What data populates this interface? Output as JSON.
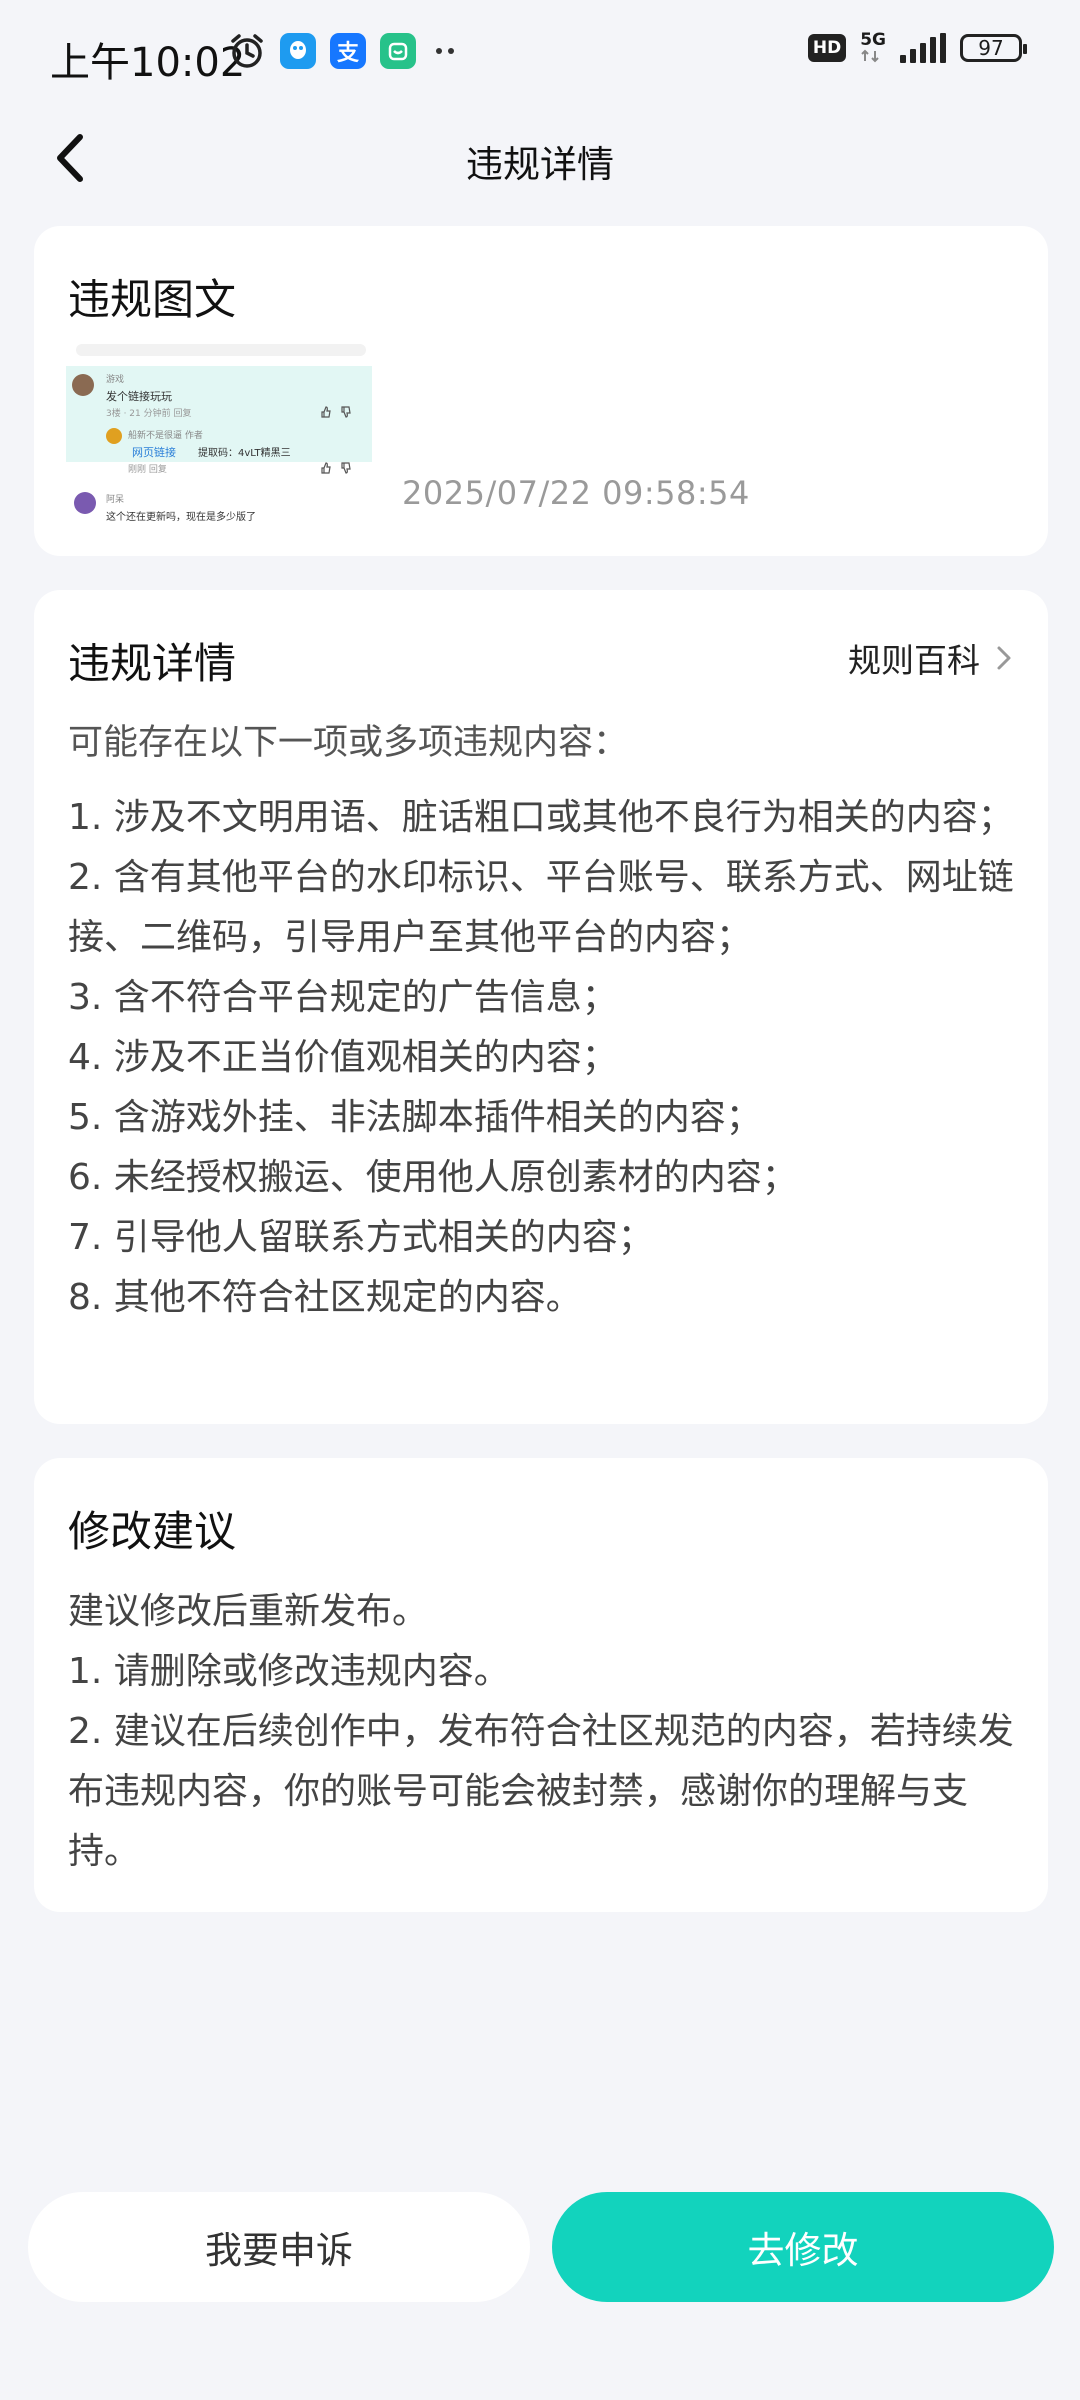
{
  "status_bar": {
    "time": "上午10:02",
    "hd": "HD",
    "network": "5G",
    "battery": "97"
  },
  "nav": {
    "title": "违规详情"
  },
  "violation_content": {
    "title": "违规图文",
    "timestamp": "2025/07/22 09:58:54",
    "thumbnail": {
      "comment1_user": "游戏",
      "comment1_text": "发个链接玩玩",
      "comment1_meta": "3楼 · 21 分钟前  回复",
      "reply_user": "船新不是很逼  作者",
      "reply_link": "网页链接",
      "reply_code": "提取码：4vLT精黑三",
      "reply_meta": "刚刚  回复",
      "comment2_user": "阿呆",
      "comment2_text": "这个还在更新吗，现在是多少版了"
    }
  },
  "violation_details": {
    "title": "违规详情",
    "rules_link": "规则百科",
    "intro": "可能存在以下一项或多项违规内容：",
    "items": [
      "1. 涉及不文明用语、脏话粗口或其他不良行为相关的内容；",
      "2. 含有其他平台的水印标识、平台账号、联系方式、网址链接、二维码，引导用户至其他平台的内容；",
      "3. 含不符合平台规定的广告信息；",
      "4. 涉及不正当价值观相关的内容；",
      "5. 含游戏外挂、非法脚本插件相关的内容；",
      "6. 未经授权搬运、使用他人原创素材的内容；",
      "7. 引导他人留联系方式相关的内容；",
      "8. 其他不符合社区规定的内容。"
    ]
  },
  "suggestions": {
    "title": "修改建议",
    "lines": [
      "建议修改后重新发布。",
      "1. 请删除或修改违规内容。",
      "2. 建议在后续创作中，发布符合社区规范的内容，若持续发布违规内容，你的账号可能会被封禁，感谢你的理解与支持。"
    ]
  },
  "actions": {
    "appeal": "我要申诉",
    "edit": "去修改"
  },
  "colors": {
    "accent": "#12d3bd",
    "background": "#f4f5f9"
  }
}
